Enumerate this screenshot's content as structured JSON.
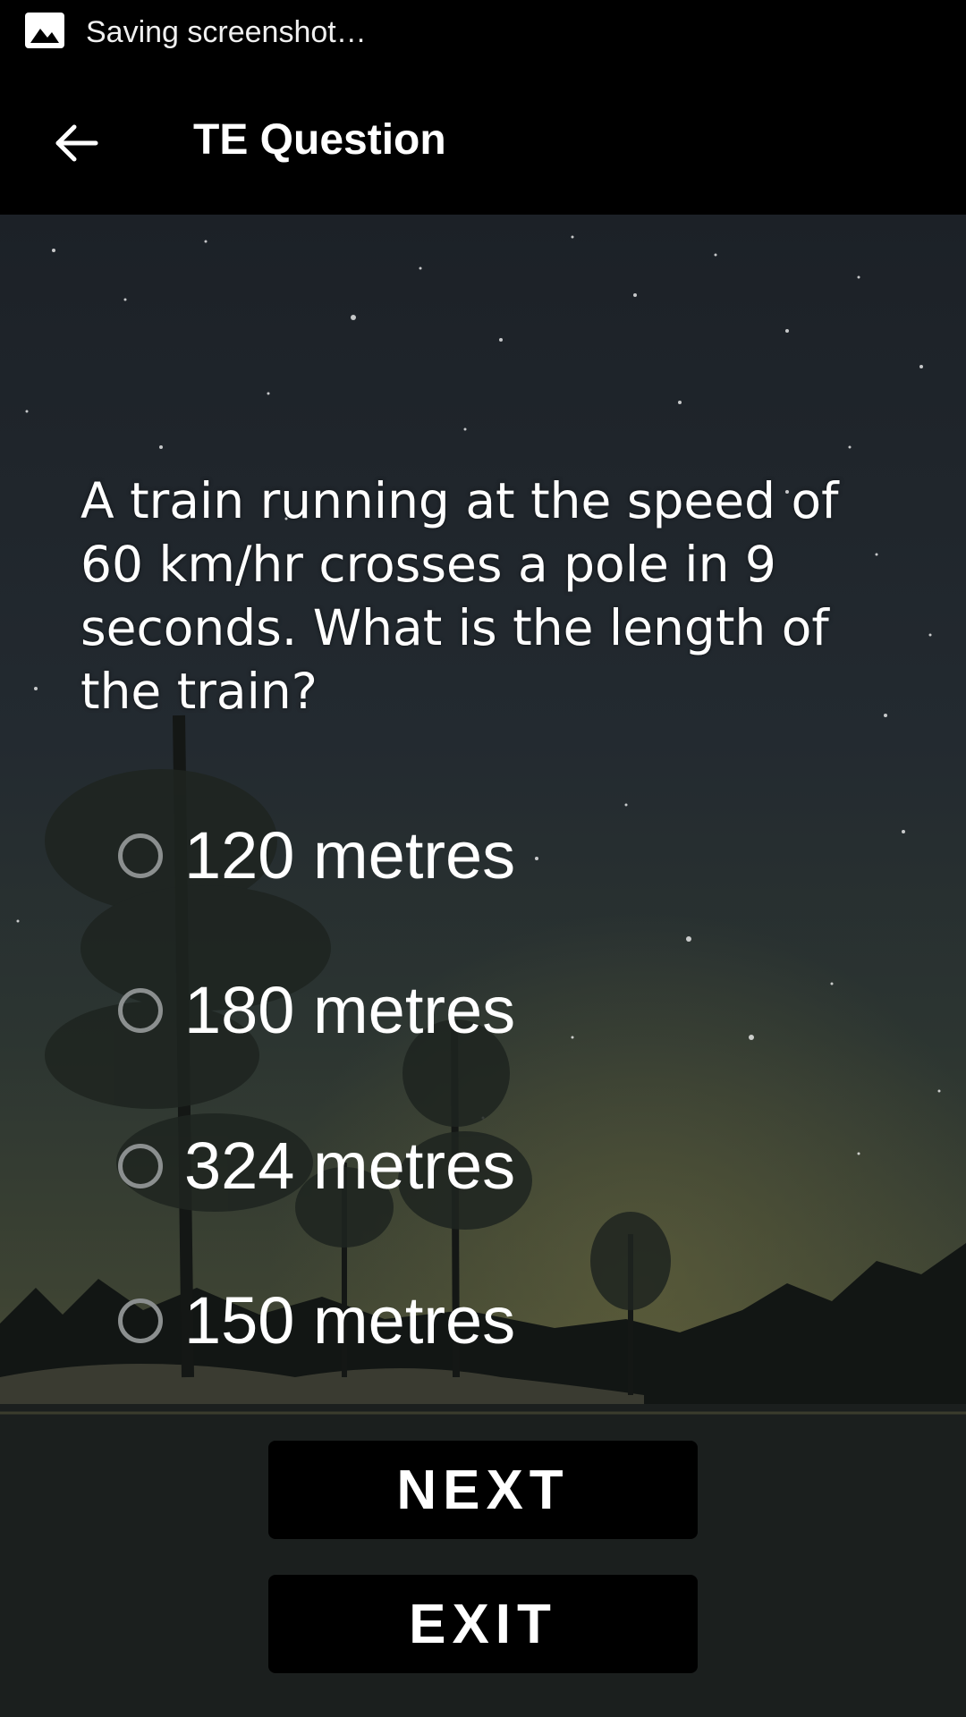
{
  "status_bar": {
    "notification_icon": "image-icon",
    "text": "Saving screenshot…"
  },
  "app_bar": {
    "back_icon": "arrow-left-icon",
    "title": "TE Question"
  },
  "question": {
    "text": "A train running at the speed of 60 km/hr crosses a pole in 9 seconds. What is the length of the train?"
  },
  "options": [
    {
      "label": "120 metres",
      "selected": false
    },
    {
      "label": "180 metres",
      "selected": false
    },
    {
      "label": "324 metres",
      "selected": false
    },
    {
      "label": "150 metres",
      "selected": false
    }
  ],
  "buttons": {
    "next_label": "NEXT",
    "exit_label": "EXIT"
  },
  "colors": {
    "bars": "#000000",
    "text": "#ffffff",
    "radio_border": "#8b8f8f"
  }
}
